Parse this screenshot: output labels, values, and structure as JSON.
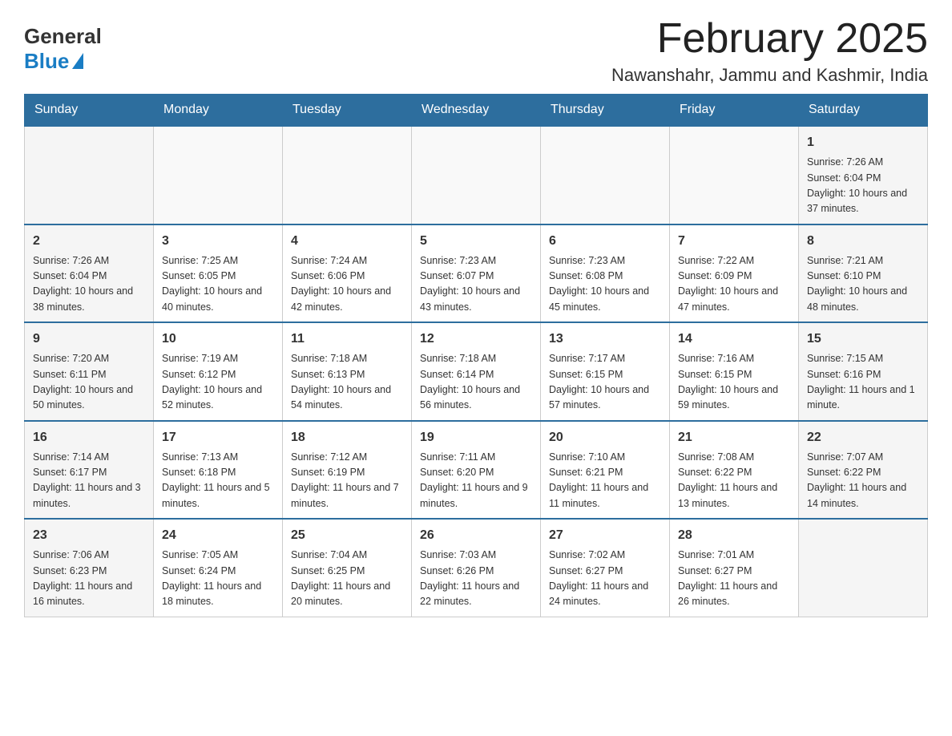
{
  "header": {
    "logo_general": "General",
    "logo_blue": "Blue",
    "month_title": "February 2025",
    "location": "Nawanshahr, Jammu and Kashmir, India"
  },
  "days_of_week": [
    "Sunday",
    "Monday",
    "Tuesday",
    "Wednesday",
    "Thursday",
    "Friday",
    "Saturday"
  ],
  "weeks": [
    [
      {
        "day": "",
        "info": ""
      },
      {
        "day": "",
        "info": ""
      },
      {
        "day": "",
        "info": ""
      },
      {
        "day": "",
        "info": ""
      },
      {
        "day": "",
        "info": ""
      },
      {
        "day": "",
        "info": ""
      },
      {
        "day": "1",
        "info": "Sunrise: 7:26 AM\nSunset: 6:04 PM\nDaylight: 10 hours and 37 minutes."
      }
    ],
    [
      {
        "day": "2",
        "info": "Sunrise: 7:26 AM\nSunset: 6:04 PM\nDaylight: 10 hours and 38 minutes."
      },
      {
        "day": "3",
        "info": "Sunrise: 7:25 AM\nSunset: 6:05 PM\nDaylight: 10 hours and 40 minutes."
      },
      {
        "day": "4",
        "info": "Sunrise: 7:24 AM\nSunset: 6:06 PM\nDaylight: 10 hours and 42 minutes."
      },
      {
        "day": "5",
        "info": "Sunrise: 7:23 AM\nSunset: 6:07 PM\nDaylight: 10 hours and 43 minutes."
      },
      {
        "day": "6",
        "info": "Sunrise: 7:23 AM\nSunset: 6:08 PM\nDaylight: 10 hours and 45 minutes."
      },
      {
        "day": "7",
        "info": "Sunrise: 7:22 AM\nSunset: 6:09 PM\nDaylight: 10 hours and 47 minutes."
      },
      {
        "day": "8",
        "info": "Sunrise: 7:21 AM\nSunset: 6:10 PM\nDaylight: 10 hours and 48 minutes."
      }
    ],
    [
      {
        "day": "9",
        "info": "Sunrise: 7:20 AM\nSunset: 6:11 PM\nDaylight: 10 hours and 50 minutes."
      },
      {
        "day": "10",
        "info": "Sunrise: 7:19 AM\nSunset: 6:12 PM\nDaylight: 10 hours and 52 minutes."
      },
      {
        "day": "11",
        "info": "Sunrise: 7:18 AM\nSunset: 6:13 PM\nDaylight: 10 hours and 54 minutes."
      },
      {
        "day": "12",
        "info": "Sunrise: 7:18 AM\nSunset: 6:14 PM\nDaylight: 10 hours and 56 minutes."
      },
      {
        "day": "13",
        "info": "Sunrise: 7:17 AM\nSunset: 6:15 PM\nDaylight: 10 hours and 57 minutes."
      },
      {
        "day": "14",
        "info": "Sunrise: 7:16 AM\nSunset: 6:15 PM\nDaylight: 10 hours and 59 minutes."
      },
      {
        "day": "15",
        "info": "Sunrise: 7:15 AM\nSunset: 6:16 PM\nDaylight: 11 hours and 1 minute."
      }
    ],
    [
      {
        "day": "16",
        "info": "Sunrise: 7:14 AM\nSunset: 6:17 PM\nDaylight: 11 hours and 3 minutes."
      },
      {
        "day": "17",
        "info": "Sunrise: 7:13 AM\nSunset: 6:18 PM\nDaylight: 11 hours and 5 minutes."
      },
      {
        "day": "18",
        "info": "Sunrise: 7:12 AM\nSunset: 6:19 PM\nDaylight: 11 hours and 7 minutes."
      },
      {
        "day": "19",
        "info": "Sunrise: 7:11 AM\nSunset: 6:20 PM\nDaylight: 11 hours and 9 minutes."
      },
      {
        "day": "20",
        "info": "Sunrise: 7:10 AM\nSunset: 6:21 PM\nDaylight: 11 hours and 11 minutes."
      },
      {
        "day": "21",
        "info": "Sunrise: 7:08 AM\nSunset: 6:22 PM\nDaylight: 11 hours and 13 minutes."
      },
      {
        "day": "22",
        "info": "Sunrise: 7:07 AM\nSunset: 6:22 PM\nDaylight: 11 hours and 14 minutes."
      }
    ],
    [
      {
        "day": "23",
        "info": "Sunrise: 7:06 AM\nSunset: 6:23 PM\nDaylight: 11 hours and 16 minutes."
      },
      {
        "day": "24",
        "info": "Sunrise: 7:05 AM\nSunset: 6:24 PM\nDaylight: 11 hours and 18 minutes."
      },
      {
        "day": "25",
        "info": "Sunrise: 7:04 AM\nSunset: 6:25 PM\nDaylight: 11 hours and 20 minutes."
      },
      {
        "day": "26",
        "info": "Sunrise: 7:03 AM\nSunset: 6:26 PM\nDaylight: 11 hours and 22 minutes."
      },
      {
        "day": "27",
        "info": "Sunrise: 7:02 AM\nSunset: 6:27 PM\nDaylight: 11 hours and 24 minutes."
      },
      {
        "day": "28",
        "info": "Sunrise: 7:01 AM\nSunset: 6:27 PM\nDaylight: 11 hours and 26 minutes."
      },
      {
        "day": "",
        "info": ""
      }
    ]
  ]
}
